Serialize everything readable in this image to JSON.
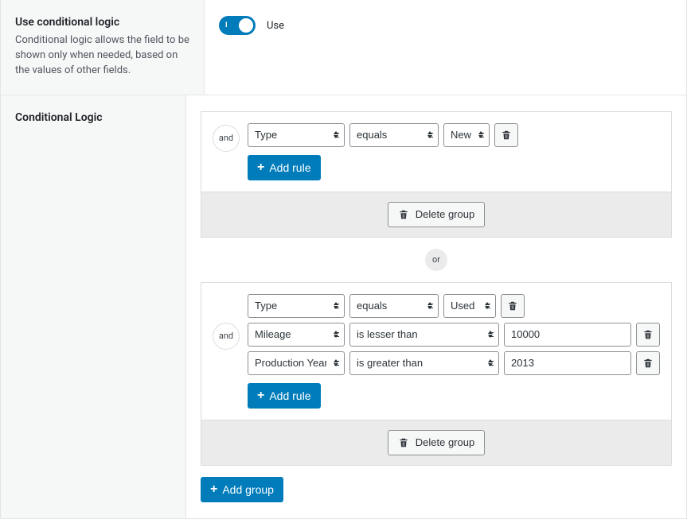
{
  "sections": {
    "use_conditional": {
      "title": "Use conditional logic",
      "description": "Conditional logic allows the field to be shown only when needed, based on the values of other fields.",
      "toggle_label": "Use",
      "toggle_indicator": "I"
    },
    "conditional_logic": {
      "title": "Conditional Logic"
    }
  },
  "labels": {
    "and": "and",
    "or": "or",
    "add_rule": "Add rule",
    "delete_group": "Delete group",
    "add_group": "Add group"
  },
  "groups": [
    {
      "rules": [
        {
          "field": "Type",
          "op": "equals",
          "value": "New",
          "value_type": "select"
        }
      ]
    },
    {
      "rules": [
        {
          "field": "Type",
          "op": "equals",
          "value": "Used",
          "value_type": "select"
        },
        {
          "field": "Mileage",
          "op": "is lesser than",
          "value": "10000",
          "value_type": "text"
        },
        {
          "field": "Production Year",
          "op": "is greater than",
          "value": "2013",
          "value_type": "text"
        }
      ]
    }
  ]
}
